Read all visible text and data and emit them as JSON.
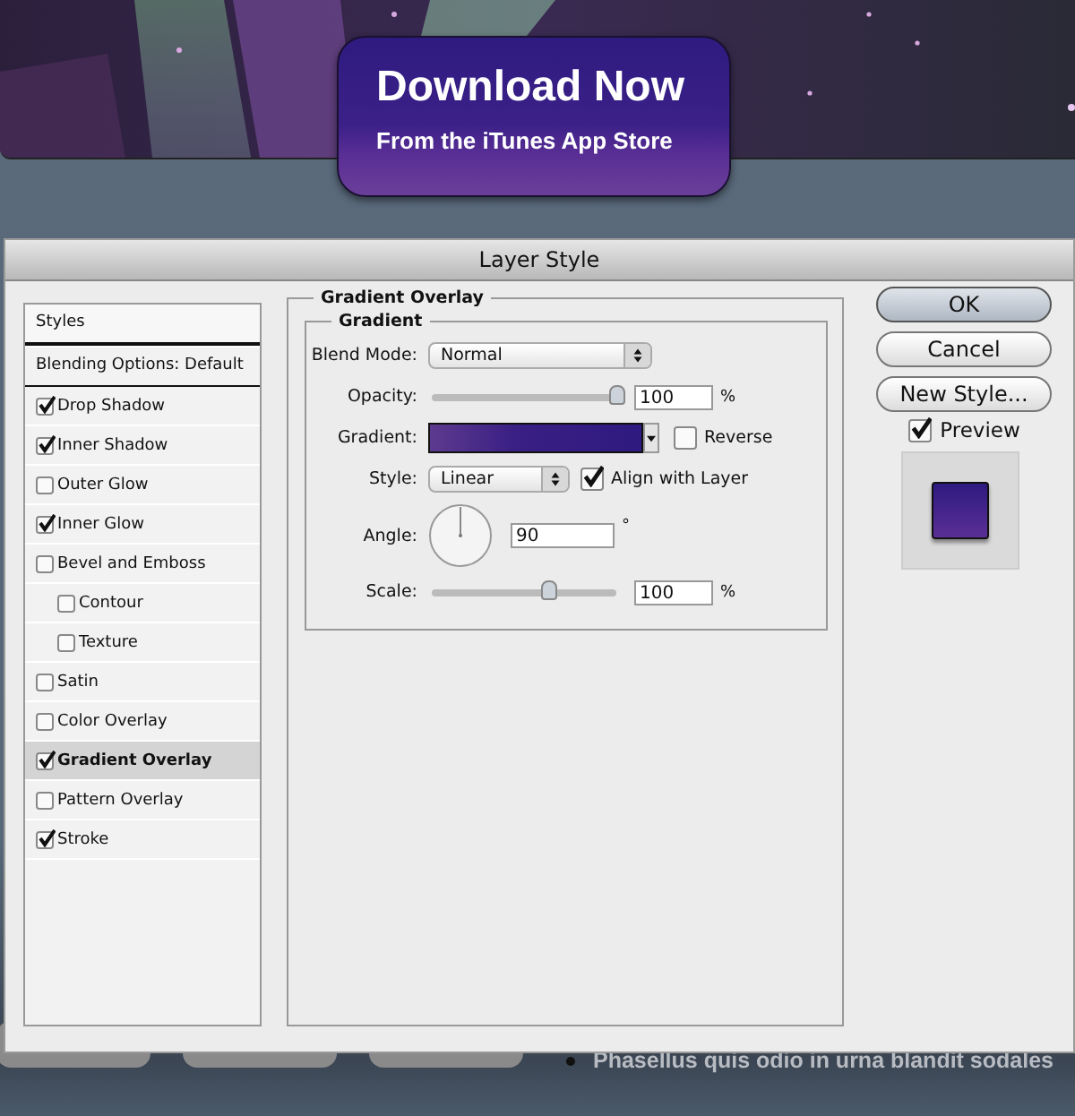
{
  "banner": {
    "title": "Download Now",
    "subtitle": "From the iTunes App Store"
  },
  "dialog": {
    "title": "Layer Style",
    "styles_header": "Styles",
    "blending_options": "Blending Options: Default",
    "effects": [
      {
        "label": "Drop Shadow",
        "checked": true,
        "selected": false
      },
      {
        "label": "Inner Shadow",
        "checked": true,
        "selected": false
      },
      {
        "label": "Outer Glow",
        "checked": false,
        "selected": false
      },
      {
        "label": "Inner Glow",
        "checked": true,
        "selected": false
      },
      {
        "label": "Bevel and Emboss",
        "checked": false,
        "selected": false,
        "children": [
          {
            "label": "Contour",
            "checked": false,
            "selected": false
          },
          {
            "label": "Texture",
            "checked": false,
            "selected": false
          }
        ]
      },
      {
        "label": "Satin",
        "checked": false,
        "selected": false
      },
      {
        "label": "Color Overlay",
        "checked": false,
        "selected": false
      },
      {
        "label": "Gradient Overlay",
        "checked": true,
        "selected": true
      },
      {
        "label": "Pattern Overlay",
        "checked": false,
        "selected": false
      },
      {
        "label": "Stroke",
        "checked": true,
        "selected": false
      }
    ],
    "panel": {
      "title": "Gradient Overlay",
      "group": "Gradient",
      "blend_mode": {
        "label": "Blend Mode:",
        "value": "Normal"
      },
      "opacity": {
        "label": "Opacity:",
        "level": 1,
        "value": "100",
        "unit": "%"
      },
      "gradient": {
        "label": "Gradient:"
      },
      "reverse": {
        "label": "Reverse",
        "checked": false
      },
      "style": {
        "label": "Style:",
        "value": "Linear"
      },
      "align": {
        "label": "Align with Layer",
        "checked": true
      },
      "angle": {
        "label": "Angle:",
        "value": "90",
        "unit": "°"
      },
      "scale": {
        "label": "Scale:",
        "level": 0.63,
        "value": "100",
        "unit": "%"
      }
    },
    "buttons": [
      {
        "label": "OK",
        "kind": "default"
      },
      {
        "label": "Cancel",
        "kind": "normal"
      },
      {
        "label": "New Style...",
        "kind": "normal"
      }
    ],
    "preview": {
      "label": "Preview",
      "checked": true
    }
  },
  "bullets": [
    "Phasellus quis odio in urna blandit sodales"
  ]
}
